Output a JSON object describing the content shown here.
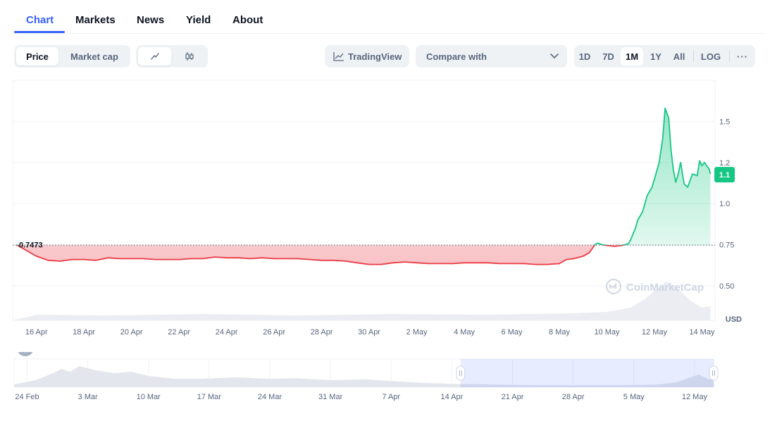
{
  "tabs": [
    {
      "label": "Chart",
      "active": true
    },
    {
      "label": "Markets",
      "active": false
    },
    {
      "label": "News",
      "active": false
    },
    {
      "label": "Yield",
      "active": false
    },
    {
      "label": "About",
      "active": false
    }
  ],
  "toolbar": {
    "price_label": "Price",
    "marketcap_label": "Market cap",
    "line_icon": "line-chart-icon",
    "candle_icon": "candlestick-icon",
    "tradingview_label": "TradingView",
    "compare_label": "Compare with",
    "ranges": [
      "1D",
      "7D",
      "1M",
      "1Y",
      "All"
    ],
    "active_range": "1M",
    "log_label": "LOG",
    "more_label": "···"
  },
  "colors": {
    "accent": "#3861fb",
    "up": "#16c784",
    "down": "#ea3943"
  },
  "watermark": "CoinMarketCap",
  "chart_data": {
    "type": "line",
    "currency_label": "USD",
    "baseline": 0.7473,
    "baseline_label": "0.7473",
    "current_value_label": "1.1",
    "y_ticks": [
      "0.50",
      "0.75",
      "1.0",
      "1.2",
      "1.5"
    ],
    "y_tick_values": [
      0.5,
      0.75,
      1.0,
      1.25,
      1.5
    ],
    "ylim": [
      0.29,
      1.75
    ],
    "x_ticks": [
      "16 Apr",
      "18 Apr",
      "20 Apr",
      "22 Apr",
      "24 Apr",
      "26 Apr",
      "28 Apr",
      "30 Apr",
      "2 May",
      "4 May",
      "6 May",
      "8 May",
      "10 May",
      "12 May",
      "14 May"
    ],
    "x_tick_days": [
      1,
      3,
      5,
      7,
      9,
      11,
      13,
      15,
      17,
      19,
      21,
      23,
      25,
      27,
      29
    ],
    "x_day0": "15 Apr",
    "series": [
      {
        "points": [
          [
            0.15,
            0.75
          ],
          [
            1.0,
            0.68
          ],
          [
            1.5,
            0.655
          ],
          [
            2.0,
            0.65
          ],
          [
            2.5,
            0.66
          ],
          [
            3.0,
            0.66
          ],
          [
            3.5,
            0.655
          ],
          [
            4.0,
            0.67
          ],
          [
            4.5,
            0.665
          ],
          [
            5.0,
            0.665
          ],
          [
            5.5,
            0.665
          ],
          [
            6.0,
            0.66
          ],
          [
            6.5,
            0.66
          ],
          [
            7.0,
            0.66
          ],
          [
            7.5,
            0.665
          ],
          [
            8.0,
            0.665
          ],
          [
            8.5,
            0.675
          ],
          [
            9.0,
            0.67
          ],
          [
            9.5,
            0.67
          ],
          [
            10.0,
            0.665
          ],
          [
            10.5,
            0.67
          ],
          [
            11.0,
            0.665
          ],
          [
            11.5,
            0.665
          ],
          [
            12.0,
            0.665
          ],
          [
            12.5,
            0.66
          ],
          [
            13.0,
            0.655
          ],
          [
            13.5,
            0.655
          ],
          [
            14.0,
            0.65
          ],
          [
            14.5,
            0.64
          ],
          [
            15.0,
            0.63
          ],
          [
            15.5,
            0.63
          ],
          [
            16.0,
            0.64
          ],
          [
            16.5,
            0.645
          ],
          [
            17.0,
            0.64
          ],
          [
            17.5,
            0.635
          ],
          [
            18.0,
            0.635
          ],
          [
            18.5,
            0.635
          ],
          [
            19.0,
            0.64
          ],
          [
            19.5,
            0.64
          ],
          [
            20.0,
            0.64
          ],
          [
            20.5,
            0.635
          ],
          [
            21.0,
            0.635
          ],
          [
            21.5,
            0.635
          ],
          [
            22.0,
            0.63
          ],
          [
            22.5,
            0.63
          ],
          [
            23.0,
            0.635
          ],
          [
            23.3,
            0.66
          ],
          [
            23.6,
            0.665
          ],
          [
            24.0,
            0.68
          ],
          [
            24.25,
            0.7
          ],
          [
            24.45,
            0.74
          ],
          [
            24.5,
            0.75
          ],
          [
            24.6,
            0.76
          ],
          [
            24.8,
            0.75
          ],
          [
            25.0,
            0.745
          ],
          [
            25.3,
            0.74
          ],
          [
            25.6,
            0.745
          ],
          [
            25.9,
            0.755
          ],
          [
            26.0,
            0.78
          ],
          [
            26.2,
            0.85
          ],
          [
            26.3,
            0.9
          ],
          [
            26.5,
            0.95
          ],
          [
            26.7,
            1.05
          ],
          [
            26.9,
            1.1
          ],
          [
            27.0,
            1.15
          ],
          [
            27.2,
            1.25
          ],
          [
            27.35,
            1.4
          ],
          [
            27.45,
            1.58
          ],
          [
            27.6,
            1.52
          ],
          [
            27.7,
            1.32
          ],
          [
            27.8,
            1.2
          ],
          [
            27.9,
            1.13
          ],
          [
            28.0,
            1.18
          ],
          [
            28.1,
            1.25
          ],
          [
            28.25,
            1.12
          ],
          [
            28.4,
            1.1
          ],
          [
            28.6,
            1.18
          ],
          [
            28.8,
            1.17
          ],
          [
            28.9,
            1.26
          ],
          [
            29.0,
            1.23
          ],
          [
            29.1,
            1.25
          ],
          [
            29.3,
            1.21
          ],
          [
            29.35,
            1.18
          ]
        ]
      }
    ],
    "volume": [
      [
        1,
        0.08
      ],
      [
        4,
        0.07
      ],
      [
        8,
        0.09
      ],
      [
        12,
        0.07
      ],
      [
        16,
        0.09
      ],
      [
        20,
        0.08
      ],
      [
        23.5,
        0.1
      ],
      [
        25,
        0.12
      ],
      [
        26,
        0.18
      ],
      [
        26.6,
        0.3
      ],
      [
        27,
        0.42
      ],
      [
        27.5,
        0.55
      ],
      [
        28,
        0.45
      ],
      [
        28.5,
        0.28
      ],
      [
        29,
        0.18
      ],
      [
        29.35,
        0.2
      ]
    ],
    "navigator": {
      "x_ticks": [
        "24 Feb",
        "3 Mar",
        "10 Mar",
        "17 Mar",
        "24 Mar",
        "31 Mar",
        "7 Apr",
        "14 Apr",
        "21 Apr",
        "28 Apr",
        "5 May",
        "12 May"
      ],
      "x_tick_days": [
        0,
        7,
        14,
        21,
        28,
        35,
        42,
        49,
        56,
        63,
        70,
        77
      ],
      "x_day0": "24 Feb",
      "selection_days": [
        50,
        79.2
      ],
      "series": [
        [
          -1.5,
          0.1
        ],
        [
          1,
          0.25
        ],
        [
          3,
          0.5
        ],
        [
          4,
          0.65
        ],
        [
          5,
          0.55
        ],
        [
          6,
          0.75
        ],
        [
          8,
          0.6
        ],
        [
          10,
          0.5
        ],
        [
          12,
          0.55
        ],
        [
          14,
          0.4
        ],
        [
          17,
          0.3
        ],
        [
          20,
          0.3
        ],
        [
          24,
          0.35
        ],
        [
          28,
          0.3
        ],
        [
          31,
          0.32
        ],
        [
          35,
          0.25
        ],
        [
          39,
          0.28
        ],
        [
          42,
          0.22
        ],
        [
          46,
          0.15
        ],
        [
          49,
          0.12
        ],
        [
          53,
          0.1
        ],
        [
          56,
          0.08
        ],
        [
          60,
          0.07
        ],
        [
          64,
          0.07
        ],
        [
          68,
          0.07
        ],
        [
          71,
          0.08
        ],
        [
          73,
          0.1
        ],
        [
          75,
          0.18
        ],
        [
          76.5,
          0.35
        ],
        [
          77.5,
          0.45
        ],
        [
          78.5,
          0.3
        ],
        [
          79.2,
          0.25
        ]
      ]
    }
  }
}
